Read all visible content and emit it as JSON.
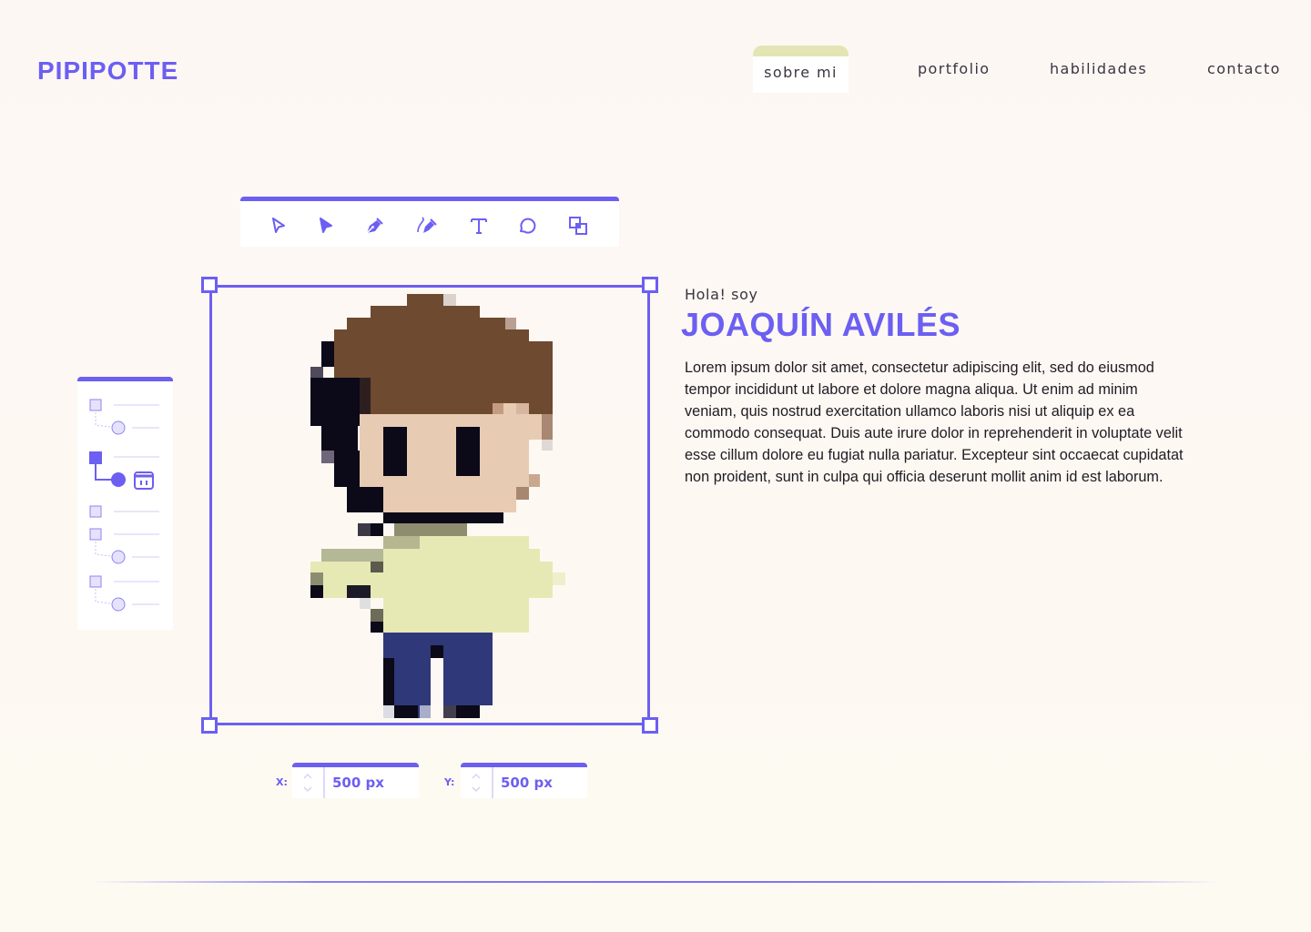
{
  "brand": {
    "logo": "PIPIPOTTE",
    "accent": "#6c5ff2",
    "highlight": "#e3e6b4"
  },
  "nav": {
    "items": [
      {
        "label": "sobre mi",
        "active": true
      },
      {
        "label": "portfolio",
        "active": false
      },
      {
        "label": "habilidades",
        "active": false
      },
      {
        "label": "contacto",
        "active": false
      }
    ]
  },
  "toolbar": {
    "tools": [
      "select-arrow-outline-icon",
      "select-arrow-solid-icon",
      "pen-icon",
      "pen-curve-icon",
      "text-icon",
      "comment-icon",
      "boolean-icon"
    ]
  },
  "canvas": {
    "x": {
      "label": "X:",
      "value": "500 px"
    },
    "y": {
      "label": "Y:",
      "value": "500 px"
    }
  },
  "layers": {
    "icons": [
      "frame-icon",
      "ellipse-icon",
      "frame-icon",
      "ellipse-icon",
      "component-icon",
      "frame-icon",
      "frame-icon",
      "ellipse-icon",
      "frame-icon",
      "ellipse-icon"
    ]
  },
  "intro": {
    "greeting": "Hola! soy",
    "name": "JOAQUÍN AVILÉS",
    "bio": "Lorem ipsum dolor sit amet, consectetur adipiscing elit, sed do eiusmod tempor incididunt ut labore et dolore magna aliqua. Ut enim ad minim veniam, quis nostrud exercitation ullamco laboris nisi ut aliquip ex ea commodo consequat. Duis aute irure dolor in reprehenderit in voluptate velit esse cillum dolore eu fugiat nulla pariatur. Excepteur sint occaecat cupidatat non proident, sunt in culpa qui officia deserunt mollit anim id est laborum."
  }
}
